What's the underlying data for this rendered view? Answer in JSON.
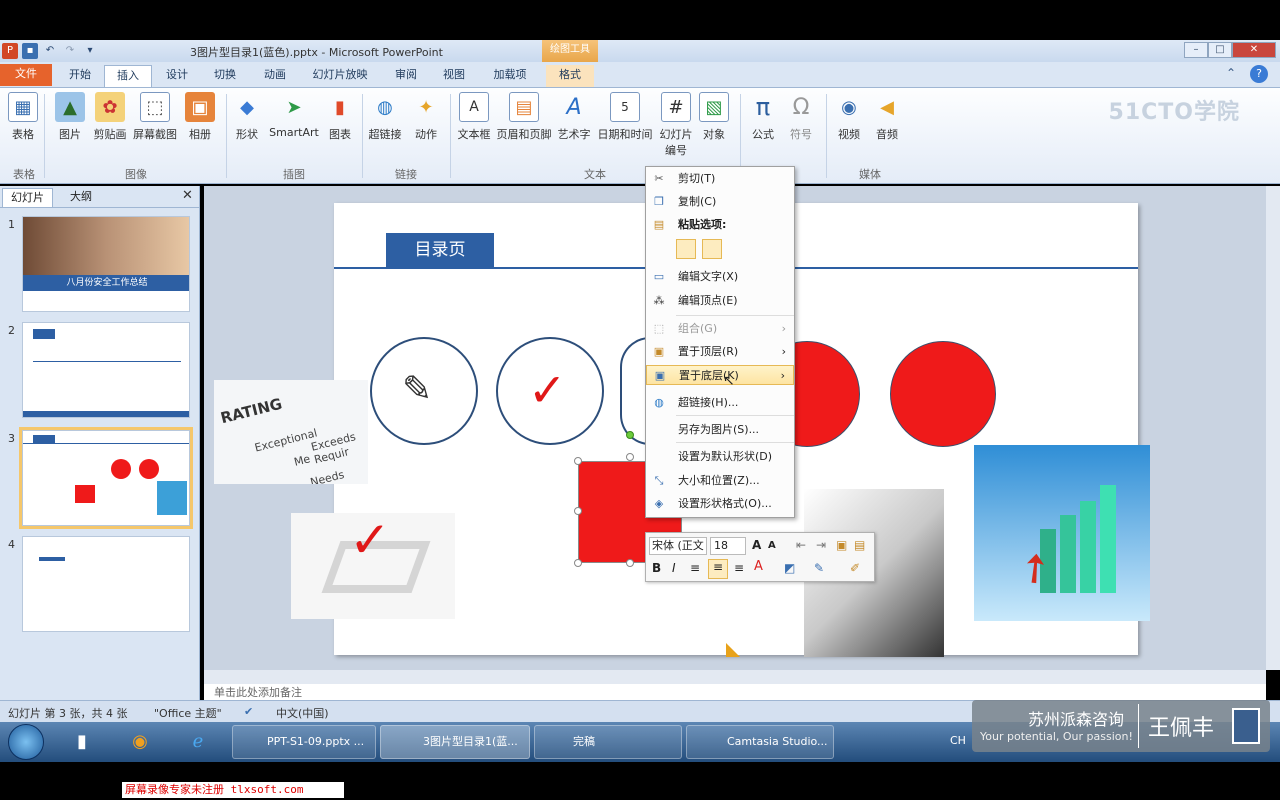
{
  "window": {
    "title": "3图片型目录1(蓝色).pptx - Microsoft PowerPoint",
    "context_tab_group": "绘图工具"
  },
  "tabs": [
    "文件",
    "开始",
    "插入",
    "设计",
    "切换",
    "动画",
    "幻灯片放映",
    "审阅",
    "视图",
    "加载项",
    "格式"
  ],
  "ribbon": {
    "groups": {
      "tables": "表格",
      "images": "图像",
      "illustrations": "插图",
      "links": "链接",
      "text": "文本",
      "media": "媒体"
    },
    "buttons": {
      "table": "表格",
      "picture": "图片",
      "clipart": "剪贴画",
      "screenshot": "屏幕截图",
      "album": "相册",
      "shapes": "形状",
      "smartart": "SmartArt",
      "chart": "图表",
      "hyperlink": "超链接",
      "action": "动作",
      "textbox": "文本框",
      "header_footer": "页眉和页脚",
      "wordart": "艺术字",
      "datetime": "日期和时间",
      "slide_number_1": "幻灯片",
      "slide_number_2": "编号",
      "object": "对象",
      "equation": "公式",
      "symbol": "符号",
      "video": "视频",
      "audio": "音频"
    },
    "watermark": "51CTO学院"
  },
  "left_panel": {
    "tabs": [
      "幻灯片",
      "大纲"
    ],
    "slide_numbers": [
      "1",
      "2",
      "3",
      "4"
    ],
    "thumb1_title": "八月份安全工作总结"
  },
  "slide": {
    "heading": "目录页",
    "rating_text": "RATING",
    "rating_rows": [
      "Exceptional",
      "Exceeds Requir",
      "Me",
      "Needs"
    ]
  },
  "context_menu": {
    "items": [
      {
        "icon": "scissors-icon",
        "label": "剪切(T)",
        "state": "normal"
      },
      {
        "icon": "copy-icon",
        "label": "复制(C)",
        "state": "normal"
      },
      {
        "icon": "paste-icon",
        "label": "粘贴选项:",
        "state": "header"
      },
      {
        "icon": "edit-text-icon",
        "label": "编辑文字(X)",
        "state": "normal"
      },
      {
        "icon": "edit-points-icon",
        "label": "编辑顶点(E)",
        "state": "normal"
      },
      {
        "icon": "group-icon",
        "label": "组合(G)",
        "state": "disabled"
      },
      {
        "icon": "bring-front-icon",
        "label": "置于顶层(R)",
        "state": "normal"
      },
      {
        "icon": "send-back-icon",
        "label": "置于底层(K)",
        "state": "highlighted"
      },
      {
        "icon": "hyperlink-icon",
        "label": "超链接(H)...",
        "state": "normal"
      },
      {
        "icon": "save-picture-icon",
        "label": "另存为图片(S)...",
        "state": "normal"
      },
      {
        "icon": "default-shape-icon",
        "label": "设置为默认形状(D)",
        "state": "normal"
      },
      {
        "icon": "size-position-icon",
        "label": "大小和位置(Z)...",
        "state": "normal"
      },
      {
        "icon": "format-shape-icon",
        "label": "设置形状格式(O)...",
        "state": "normal"
      }
    ]
  },
  "mini_toolbar": {
    "font_name": "宋体 (正文",
    "font_size": "18"
  },
  "notes_placeholder": "单击此处添加备注",
  "status_bar": {
    "slide_info": "幻灯片 第 3 张，共 4 张",
    "theme": "\"Office 主题\"",
    "language": "中文(中国)"
  },
  "taskbar": {
    "items": [
      "PPT-S1-09.pptx ...",
      "3图片型目录1(蓝...",
      "完稿",
      "Camtasia Studio..."
    ],
    "lang": "CH"
  },
  "brand": {
    "company": "苏州派森咨询",
    "slogan": "Your potential, Our passion!",
    "person": "王佩丰"
  },
  "reg_note": "屏幕录像专家未注册 tlxsoft.com",
  "colors": {
    "accent": "#2d4e7a",
    "shape_red": "#ef1a1a",
    "file_tab": "#e6632c"
  }
}
